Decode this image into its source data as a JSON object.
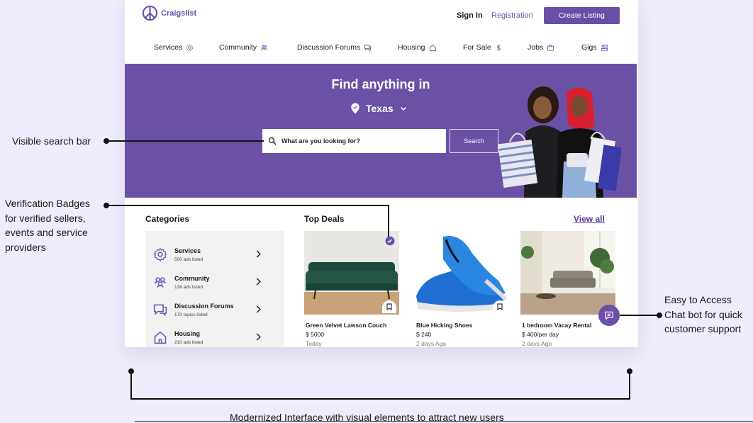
{
  "header": {
    "logo_text": "Craigslist",
    "sign_in": "Sign In",
    "registration": "Registration",
    "create_listing": "Create Listing"
  },
  "nav": [
    {
      "label": "Services",
      "icon": "gear-icon"
    },
    {
      "label": "Community",
      "icon": "people-icon"
    },
    {
      "label": "Discussion Forums",
      "icon": "chat-icon"
    },
    {
      "label": "Housing",
      "icon": "home-icon"
    },
    {
      "label": "For Sale",
      "icon": "dollar-icon"
    },
    {
      "label": "Jobs",
      "icon": "briefcase-icon"
    },
    {
      "label": "Gigs",
      "icon": "gigs-icon"
    }
  ],
  "hero": {
    "title": "Find anything in",
    "location": "Texas",
    "search_placeholder": "What are you looking for?",
    "search_button": "Search"
  },
  "categories": {
    "title": "Categories",
    "items": [
      {
        "name": "Services",
        "count": "500 ads listed",
        "icon": "gear-icon"
      },
      {
        "name": "Community",
        "count": "138 ads listed",
        "icon": "people-icon"
      },
      {
        "name": "Discussion Forums",
        "count": "170 topics listed",
        "icon": "chat-icon"
      },
      {
        "name": "Housing",
        "count": "210 ads listed",
        "icon": "home-icon"
      }
    ]
  },
  "deals": {
    "title": "Top Deals",
    "view_all": "View all",
    "items": [
      {
        "name": "Green Velvet Lawson Couch",
        "price": "$ 5000",
        "time": "Today",
        "verified": true
      },
      {
        "name": "Blue Hicking Shoes",
        "price": "$ 240",
        "time": "2 days Ago",
        "verified": false
      },
      {
        "name": "1 bedroom Vacay Rental",
        "price": "$ 400/per day",
        "time": "2 days Ago",
        "verified": false
      }
    ]
  },
  "annotations": {
    "search": "Visible search bar",
    "verification": [
      "Verification Badges",
      "for verified sellers,",
      "events and service",
      "providers"
    ],
    "chatbot": [
      "Easy to Access",
      "Chat bot for quick",
      "customer support"
    ],
    "bottom": "Modernized Interface with visual elements to attract new users"
  },
  "colors": {
    "brand": "#6a4fa7",
    "hero_bg": "#6a51a5",
    "page_bg": "#efedfb"
  }
}
